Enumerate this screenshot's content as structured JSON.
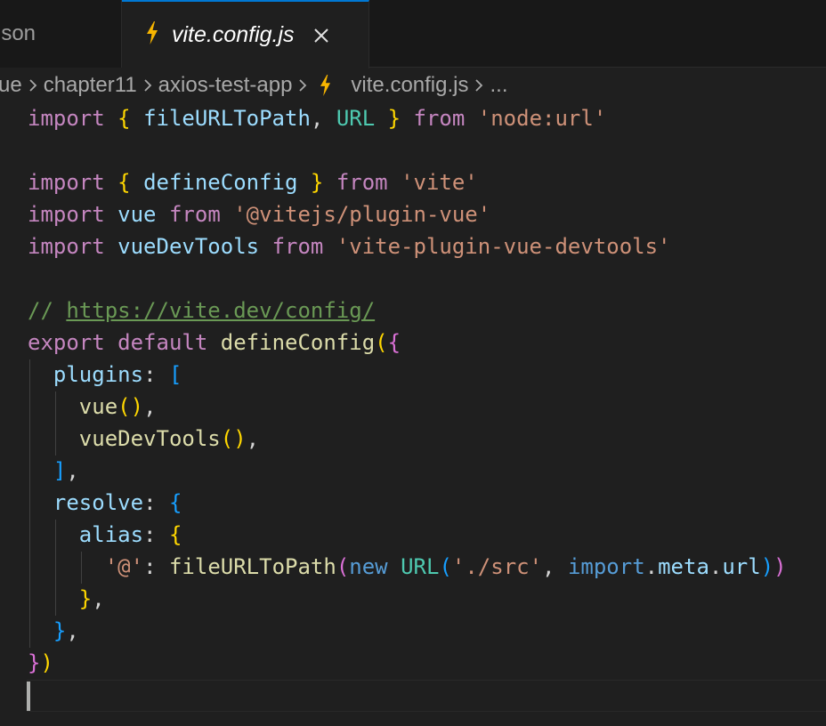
{
  "tabs": {
    "inactive_label": "json",
    "active_label": "vite.config.js"
  },
  "icons": {
    "file_icon": "lightning-bolt-icon",
    "close_icon": "close-icon",
    "chevron_icon": "chevron-right-icon"
  },
  "colors": {
    "active_tab_border": "#0078d4",
    "vite_icon": "#f7b500",
    "editor_bg": "#1f1f1f"
  },
  "breadcrumb": {
    "items": [
      "ue",
      "chapter11",
      "axios-test-app",
      "vite.config.js",
      "..."
    ]
  },
  "code": {
    "lines": [
      "import { fileURLToPath, URL } from 'node:url'",
      "",
      "import { defineConfig } from 'vite'",
      "import vue from '@vitejs/plugin-vue'",
      "import vueDevTools from 'vite-plugin-vue-devtools'",
      "",
      "// https://vite.dev/config/",
      "export default defineConfig({",
      "  plugins: [",
      "    vue(),",
      "    vueDevTools(),",
      "  ],",
      "  resolve: {",
      "    alias: {",
      "      '@': fileURLToPath(new URL('./src', import.meta.url))",
      "    },",
      "  },",
      "})",
      ""
    ]
  }
}
